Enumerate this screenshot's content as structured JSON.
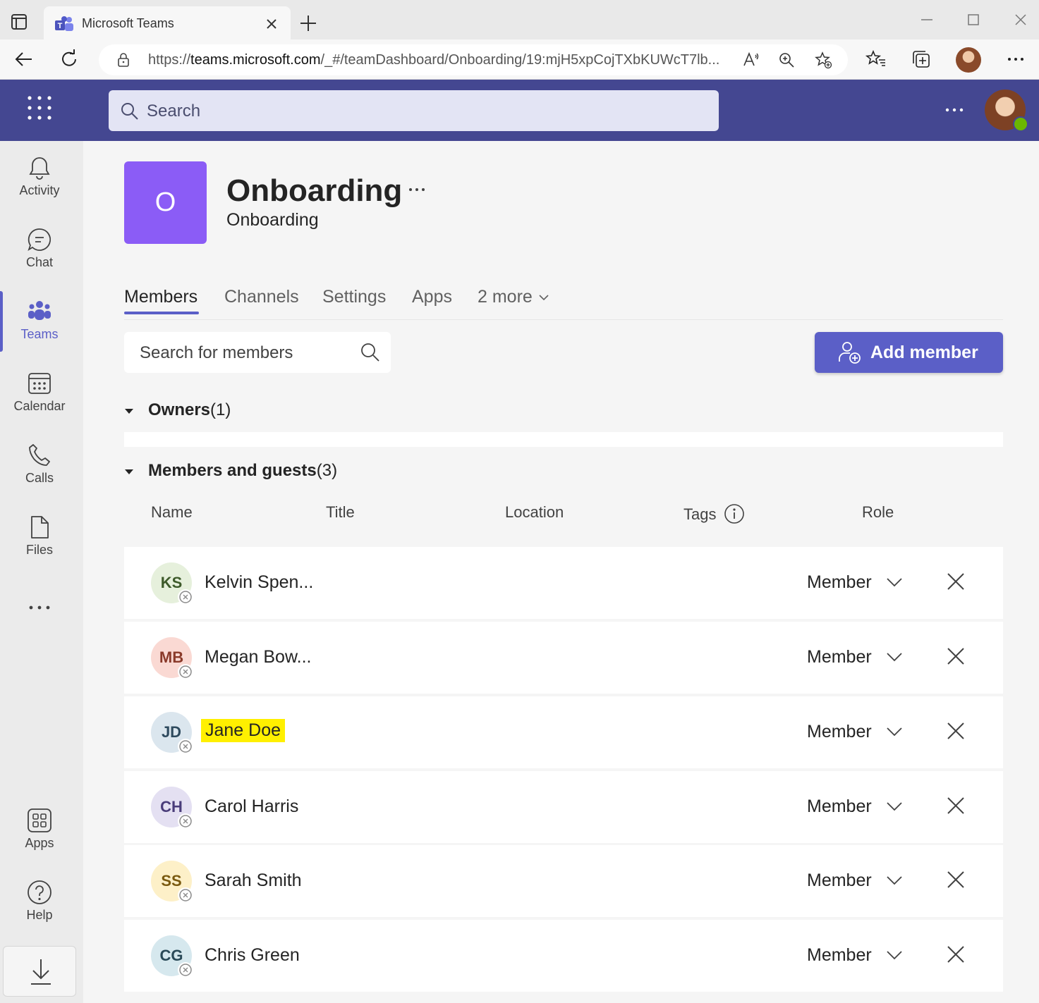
{
  "browser": {
    "tab_title": "Microsoft Teams",
    "url_prefix": "https://",
    "url_host": "teams.microsoft.com",
    "url_path": "/_#/teamDashboard/Onboarding/19:mjH5xpCojTXbKUWcT7lb..."
  },
  "header": {
    "search_placeholder": "Search"
  },
  "rail": {
    "items": [
      {
        "label": "Activity",
        "icon": "bell-icon"
      },
      {
        "label": "Chat",
        "icon": "chat-icon"
      },
      {
        "label": "Teams",
        "icon": "teams-icon",
        "active": true
      },
      {
        "label": "Calendar",
        "icon": "calendar-icon"
      },
      {
        "label": "Calls",
        "icon": "phone-icon"
      },
      {
        "label": "Files",
        "icon": "file-icon"
      },
      {
        "label": "Apps",
        "icon": "apps-icon"
      },
      {
        "label": "Help",
        "icon": "help-icon"
      }
    ]
  },
  "team": {
    "initial": "O",
    "name": "Onboarding",
    "subtitle": "Onboarding",
    "tile_color": "#8b5cf6"
  },
  "tabs": [
    {
      "label": "Members",
      "active": true
    },
    {
      "label": "Channels"
    },
    {
      "label": "Settings"
    },
    {
      "label": "Apps"
    },
    {
      "label": "2 more"
    }
  ],
  "member_search": {
    "placeholder": "Search for members"
  },
  "add_member_label": "Add member",
  "owners": {
    "title": "Owners",
    "count": "(1)"
  },
  "members_section": {
    "title": "Members and guests",
    "count": "(3)"
  },
  "columns": {
    "name": "Name",
    "title": "Title",
    "location": "Location",
    "tags": "Tags",
    "role": "Role"
  },
  "members": [
    {
      "initials": "KS",
      "name": "Kelvin Spen...",
      "role": "Member",
      "avatar_bg": "#e6f0dc",
      "avatar_fg": "#3d5a2a",
      "highlighted": false
    },
    {
      "initials": "MB",
      "name": "Megan Bow...",
      "role": "Member",
      "avatar_bg": "#fad9d3",
      "avatar_fg": "#8a3a2a",
      "highlighted": false
    },
    {
      "initials": "JD",
      "name": "Jane Doe",
      "role": "Member",
      "avatar_bg": "#dbe6ee",
      "avatar_fg": "#2e4a5e",
      "highlighted": true
    },
    {
      "initials": "CH",
      "name": "Carol Harris",
      "role": "Member",
      "avatar_bg": "#e4e0f2",
      "avatar_fg": "#4a3d7a",
      "highlighted": false
    },
    {
      "initials": "SS",
      "name": "Sarah Smith",
      "role": "Member",
      "avatar_bg": "#fdf0c8",
      "avatar_fg": "#7a5a10",
      "highlighted": false
    },
    {
      "initials": "CG",
      "name": "Chris Green",
      "role": "Member",
      "avatar_bg": "#d6e8ee",
      "avatar_fg": "#2a4a58",
      "highlighted": false
    }
  ],
  "colors": {
    "brand": "#5b5fc7",
    "header_bg": "#444791",
    "highlight": "#fff000"
  }
}
